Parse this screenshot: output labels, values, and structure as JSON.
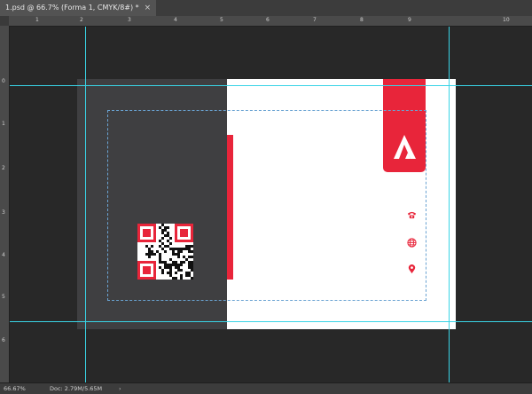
{
  "document_tab": {
    "title": "1.psd @ 66.7% (Forma 1, CMYK/8#) *",
    "close_symbol": "×"
  },
  "ruler": {
    "top_labels": [
      "1",
      "2",
      "3",
      "4",
      "5",
      "6",
      "7",
      "8",
      "9",
      "10"
    ],
    "left_labels": [
      "0",
      "1",
      "2",
      "3",
      "4",
      "5",
      "6"
    ]
  },
  "status_bar": {
    "zoom": "66.67%",
    "doc_info": "Doc: 2.79M/5.65M",
    "arrow": "›"
  },
  "artwork": {
    "colors": {
      "accent": "#e8253a",
      "back_panel": "#3f3f41",
      "front_panel": "#ffffff",
      "guide": "#39d4e6",
      "margin": "#6aa3d2"
    },
    "logo_icon": "triangle-a-logo-icon",
    "contact_icons": [
      "phone-icon",
      "globe-icon",
      "location-pin-icon"
    ]
  }
}
